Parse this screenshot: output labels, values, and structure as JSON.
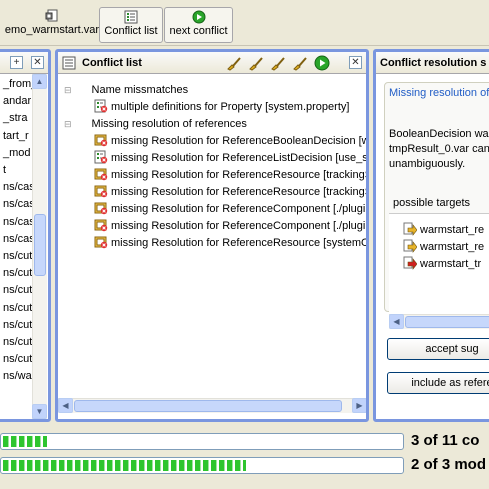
{
  "toolbar": {
    "file_label": "emo_warmstart.var",
    "conflict_list_label": "Conflict list",
    "next_conflict_label": "next conflict"
  },
  "left_panel": {
    "items": [
      "_from_",
      "andar",
      "_stra",
      "tart_r",
      "_mod",
      "t",
      "ns/cas",
      "ns/cas",
      "ns/cas",
      "ns/cas",
      "ns/cut",
      "ns/cut",
      "ns/cut",
      "ns/cut",
      "ns/cut",
      "ns/cut",
      "ns/cut",
      "ns/wa"
    ]
  },
  "conflict_panel": {
    "title": "Conflict list",
    "groups": [
      {
        "label": "Name missmatches",
        "items": [
          "multiple definitions for Property [system.property]"
        ]
      },
      {
        "label": "Missing resolution of references",
        "items": [
          "missing Resolution for ReferenceBooleanDecision [wa",
          "missing Resolution for ReferenceListDecision [use_st",
          "missing Resolution for ReferenceResource [trackingS",
          "missing Resolution for ReferenceResource [trackingS",
          "missing Resolution for ReferenceComponent [./plugin",
          "missing Resolution for ReferenceComponent [./plugin",
          "missing Resolution for ReferenceResource [systemO"
        ]
      }
    ]
  },
  "resolution_panel": {
    "title": "Conflict resolution s",
    "heading": "Missing resolution of",
    "description": [
      "BooleanDecision warm",
      "tmpResult_0.var can't",
      "unambiguously."
    ],
    "targets_label": "possible targets",
    "targets": [
      "warmstart_re",
      "warmstart_re",
      "warmstart_tr"
    ],
    "accept_label": "accept sug",
    "include_label": "include as refere"
  },
  "progress": [
    {
      "text": "3 of 11 co",
      "fraction": 0.11
    },
    {
      "text": "2 of 3 mod",
      "fraction": 0.61
    }
  ],
  "colors": {
    "panel_border": "#7a96df",
    "progress_fill": "#2ec52e",
    "link_blue": "#215dc6"
  }
}
